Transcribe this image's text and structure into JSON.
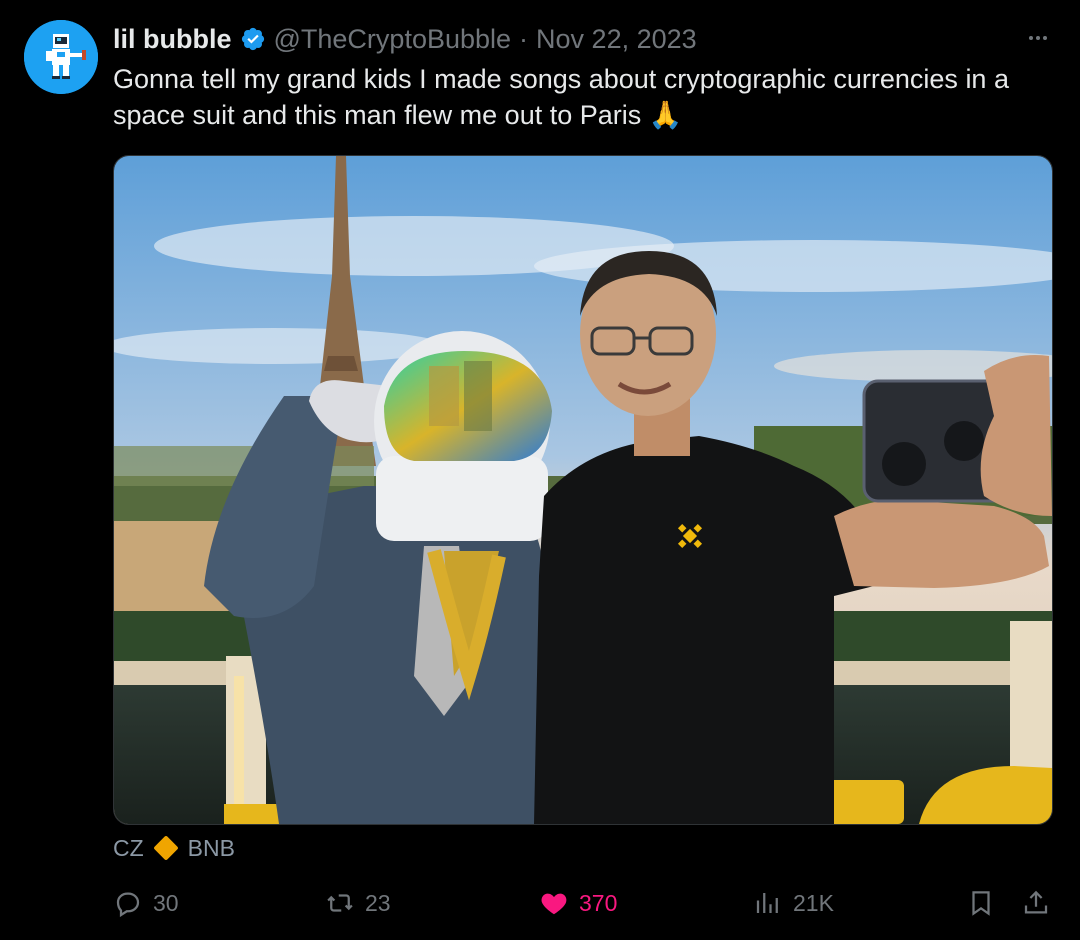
{
  "tweet": {
    "author_name": "lil bubble",
    "handle": "@TheCryptoBubble",
    "separator": "·",
    "date": "Nov 22, 2023",
    "text": "Gonna tell my grand kids I made songs about cryptographic currencies in a space suit and this man flew me out to Paris",
    "emoji": "🙏",
    "verified_icon": "verified-badge-icon",
    "more_icon": "more-options-icon"
  },
  "media": {
    "image_icon": "photo"
  },
  "caption": {
    "left": "CZ",
    "right": "BNB",
    "diamond_color": "#f0a500"
  },
  "actions": {
    "replies": "30",
    "reposts": "23",
    "likes": "370",
    "views": "21K",
    "like_color": "#f91880"
  },
  "colors": {
    "background": "#000000",
    "text": "#e7e9ea",
    "muted": "#71767b",
    "accent": "#1d9bf0"
  }
}
